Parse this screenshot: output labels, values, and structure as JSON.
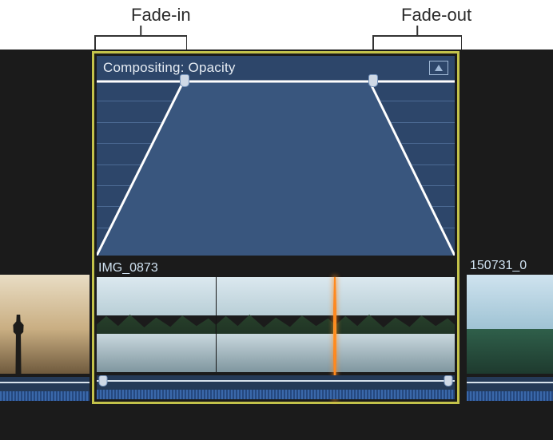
{
  "labels": {
    "fade_in": "Fade-in",
    "fade_out": "Fade-out"
  },
  "clip": {
    "animation_title": "Compositing: Opacity",
    "name": "IMG_0873"
  },
  "neighbours": {
    "left_name": "",
    "right_name": "150731_0"
  },
  "icons": {
    "animation_menu": "animation-menu-icon"
  }
}
